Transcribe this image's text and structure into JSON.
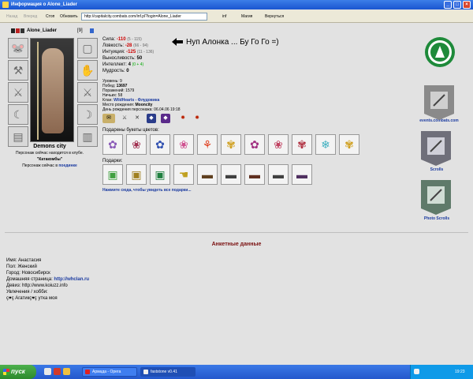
{
  "window": {
    "title": "Информация о Alone_Liader"
  },
  "toolbar": {
    "back": "Назад",
    "forward": "Вперед",
    "stop": "Стоп",
    "refresh": "Обновить",
    "address": "http://capitalcity.combats.com/inf.pl?login=Alone_Liader",
    "inf": "inf",
    "magic": "Магия",
    "return": "Вернуться"
  },
  "character": {
    "name": "Alone_Liader",
    "level": "[9]"
  },
  "stats": {
    "strength_label": "Сила:",
    "strength_value": "-110",
    "strength_sub": "(5 - 115)",
    "agility_label": "Ловкость:",
    "agility_value": "-28",
    "agility_sub": "(66 - 94)",
    "intuition_label": "Интуиция:",
    "intuition_value": "-125",
    "intuition_sub": "(11 - 136)",
    "endurance_label": "Выносливость:",
    "endurance_value": "50",
    "intellect_label": "Интеллект:",
    "intellect_value": "4",
    "intellect_sub": "(0 + 4)",
    "wisdom_label": "Мудрость:",
    "wisdom_value": "0"
  },
  "annotation": "Нуп Алонка ... Бу Го Го =)",
  "info": {
    "levels": "Уровень: 9",
    "wins_label": "Побед:",
    "wins_value": "13697",
    "losses": "Поражений: 1579",
    "draws": "Ничьих: 58",
    "clan_label": "Клан:",
    "clan_value": "WildHearts - Флудовика",
    "birthplace_label": "Место рождения:",
    "birthplace_value": "Mooncity",
    "birthday": "День рождения персонажа: 06.04.06 19:18"
  },
  "location": {
    "city": "Demons city",
    "line1": "Персонаж сейчас находится в клубе.",
    "line2": "\"Катакомбы\"",
    "line3_prefix": "Персонаж сейчас в",
    "line3_link": "поединке"
  },
  "sections": {
    "flowers_label": "Подарены букеты цветов:",
    "gifts_label": "Подарки:",
    "gifts_link": "Нажмите сюда, чтобы увидеть все подарки..."
  },
  "banners": {
    "events": "events.combats.com",
    "scrolls": "Scrolls",
    "photo": "Photo Scrolls"
  },
  "anketa": {
    "title": "Анкетные данные",
    "name": "Имя: Анастасия",
    "sex": "Пол: Женский",
    "city": "Город: Новосибирск",
    "homepage_label": "Домашняя страница:",
    "homepage_value": "http://whclan.ru",
    "motto": "Девиз: http://www.koiuzz.info",
    "hobby_label": "Увлечения / хобби:",
    "hobby_value": "ç♥ç Агатикç♥ç утка моя"
  },
  "taskbar": {
    "start": "пуск",
    "task1": "Армада - Opera",
    "task2": "faststone v0.41",
    "clock": "19:23"
  },
  "colors": {
    "accent": "#1a3aa0",
    "negative": "#cc0000",
    "title_red": "#7a1010"
  }
}
